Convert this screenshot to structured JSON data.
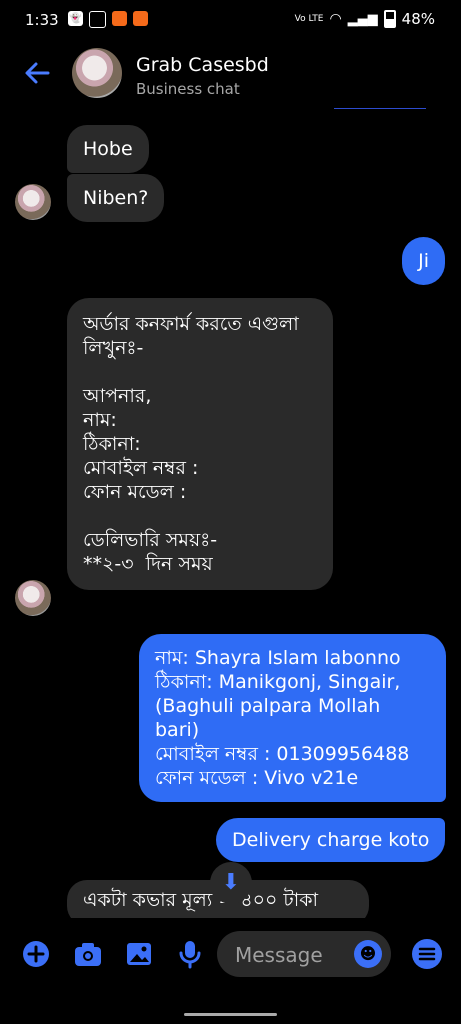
{
  "status_bar": {
    "time": "1:33",
    "battery": "48%",
    "network": "Vo LTE"
  },
  "header": {
    "back_icon": "arrow-left-icon",
    "name": "Grab Casesbd",
    "subtitle": "Business chat"
  },
  "messages": [
    {
      "side": "in",
      "text": "Hobe"
    },
    {
      "side": "in",
      "text": "Niben?"
    },
    {
      "side": "out",
      "text": "Ji"
    },
    {
      "side": "in",
      "text": "অর্ডার কনফার্ম করতে এগুলা লিখুনঃ-\n\nআপনার,\nনাম:\nঠিকানা:\nমোবাইল নম্বর :\nফোন মডেল :\n\nডেলিভারি সময়ঃ-\n**২-৩  দিন সময়"
    },
    {
      "side": "out",
      "text": "নাম: Shayra Islam labonno\nঠিকানা: Manikgonj, Singair,\n(Baghuli palpara Mollah\nbari)\nমোবাইল নম্বর : 01309956488\nফোন মডেল : Vivo v21e"
    },
    {
      "side": "out",
      "text": "Delivery charge koto"
    },
    {
      "side": "in",
      "text": "একটা কভার মূল্য = ৪০০ টাকা"
    }
  ],
  "composer": {
    "placeholder": "Message"
  },
  "colors": {
    "accent": "#3b6ff7",
    "outgoing": "#2f6cf5",
    "incoming": "#2a2a2a"
  }
}
